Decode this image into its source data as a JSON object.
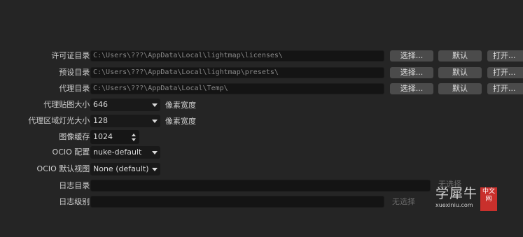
{
  "paths": {
    "license": {
      "label": "许可证目录:",
      "value": "C:\\Users\\???\\AppData\\Local\\lightmap\\licenses\\"
    },
    "presets": {
      "label": "预设目录:",
      "value": "C:\\Users\\???\\AppData\\Local\\lightmap\\presets\\"
    },
    "proxy": {
      "label": "代理目录:",
      "value": "C:\\Users\\???\\AppData\\Local\\Temp\\"
    }
  },
  "buttons": {
    "choose": "选择...",
    "default": "默认",
    "open": "打开..."
  },
  "proxy_map_size": {
    "label": "代理贴图大小:",
    "value": "646",
    "unit": "像素宽度"
  },
  "proxy_area_light_size": {
    "label": "代理区域灯光大小:",
    "value": "128",
    "unit": "像素宽度"
  },
  "image_cache": {
    "label": "图像缓存:",
    "value": "1024"
  },
  "ocio_config": {
    "label": "OCIO 配置:",
    "value": "nuke-default"
  },
  "ocio_view": {
    "label": "OCIO 默认视图:",
    "value": "None (default)"
  },
  "log_dir": {
    "label": "日志目录:",
    "value": "",
    "hint": "无选择"
  },
  "log_level": {
    "label": "日志级别:",
    "value": "",
    "hint": "无选择"
  },
  "watermark": {
    "name": "学犀牛",
    "url": "xuexiniu.com",
    "badge": "中文网"
  }
}
